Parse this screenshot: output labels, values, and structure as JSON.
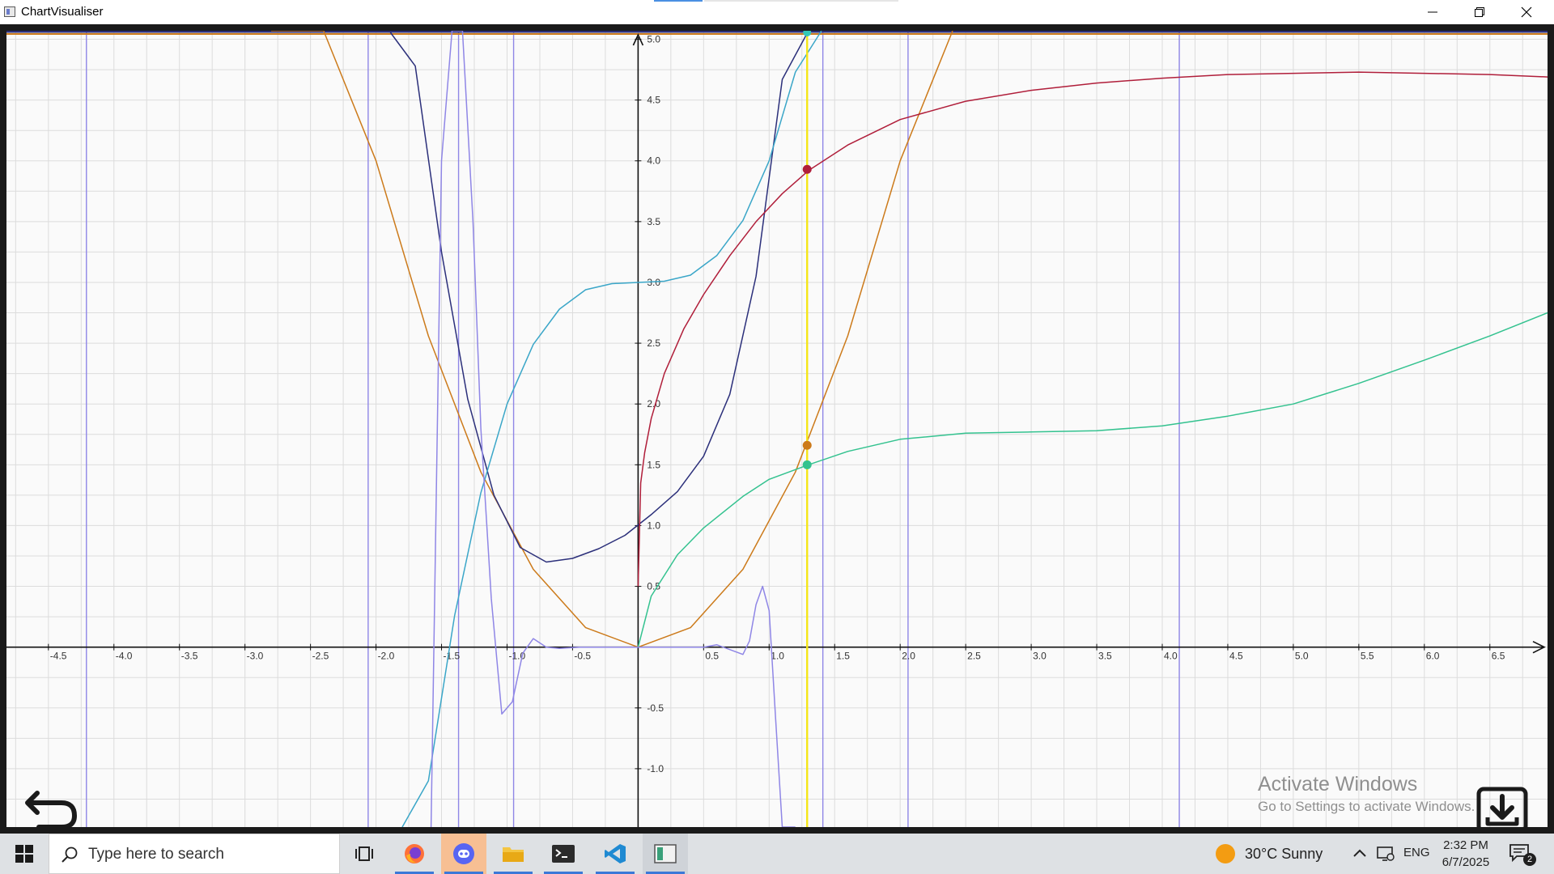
{
  "window": {
    "title": "ChartVisualiser"
  },
  "chart_data": {
    "type": "line",
    "xlim": [
      -4.82,
      6.94
    ],
    "ylim": [
      -1.48,
      5.07
    ],
    "grid": true,
    "x_ticks": [
      "-4.5",
      "-4.0",
      "-3.5",
      "-3.0",
      "-2.5",
      "-2.0",
      "-1.5",
      "-1.0",
      "-0.5",
      "0.5",
      "1.0",
      "1.5",
      "2.0",
      "2.5",
      "3.0",
      "3.5",
      "4.0",
      "4.5",
      "5.0",
      "5.5",
      "6.0",
      "6.5"
    ],
    "y_ticks": [
      "-1.0",
      "-0.5",
      "0.5",
      "1.0",
      "1.5",
      "2.0",
      "2.5",
      "3.0",
      "3.5",
      "4.0",
      "4.5",
      "5.0"
    ],
    "cursor_x": 1.29,
    "series": [
      {
        "color": "#cc7a1a",
        "x": [
          -2.8,
          -2.4,
          -2.0,
          -1.6,
          -1.2,
          -0.8,
          -0.4,
          0,
          0.4,
          0.8,
          1.2,
          1.6,
          2.0,
          2.4
        ],
        "y": [
          7.84,
          5.76,
          4.0,
          2.56,
          1.44,
          0.64,
          0.16,
          0,
          0.16,
          0.64,
          1.44,
          2.56,
          4.0,
          5.76
        ]
      },
      {
        "color": "#2b2f7a",
        "x": [
          -1.9,
          -1.7,
          -1.5,
          -1.3,
          -1.1,
          -0.9,
          -0.7,
          -0.5,
          -0.3,
          -0.1,
          0.1,
          0.3,
          0.5,
          0.7,
          0.9,
          1.1,
          1.3
        ],
        "y": [
          6.24,
          4.78,
          3.25,
          2.04,
          1.25,
          0.82,
          0.7,
          0.73,
          0.81,
          0.92,
          1.09,
          1.28,
          1.57,
          2.08,
          3.05,
          4.67,
          6.29
        ]
      },
      {
        "color": "#3aa6c8",
        "x": [
          -1.8,
          -1.6,
          -1.4,
          -1.2,
          -1.0,
          -0.8,
          -0.6,
          -0.4,
          -0.2,
          0,
          0.2,
          0.4,
          0.6,
          0.8,
          1.0,
          1.2,
          1.4
        ],
        "y": [
          -2.83,
          -1.1,
          0.26,
          1.27,
          2.0,
          2.49,
          2.78,
          2.94,
          2.99,
          3.0,
          3.01,
          3.06,
          3.22,
          3.51,
          4.0,
          4.73,
          5.74
        ]
      },
      {
        "color": "#b01e3a",
        "x": [
          0,
          0.02,
          0.05,
          0.1,
          0.2,
          0.35,
          0.5,
          0.7,
          0.9,
          1.1,
          1.3,
          1.6,
          2.0,
          2.5,
          3.0,
          3.5,
          4.0,
          4.5,
          5.0,
          5.5,
          6.0,
          6.5,
          6.94
        ],
        "y": [
          0.5,
          1.35,
          1.6,
          1.88,
          2.25,
          2.62,
          2.9,
          3.22,
          3.5,
          3.73,
          3.92,
          4.13,
          4.34,
          4.49,
          4.58,
          4.64,
          4.68,
          4.71,
          4.72,
          4.73,
          4.72,
          4.71,
          4.69
        ]
      },
      {
        "color": "#33c28f",
        "x": [
          0,
          0.1,
          0.3,
          0.5,
          0.8,
          1.0,
          1.3,
          1.6,
          2.0,
          2.5,
          3.0,
          3.5,
          4.0,
          4.5,
          5.0,
          5.5,
          6.0,
          6.5,
          6.94
        ],
        "y": [
          0,
          0.42,
          0.76,
          0.98,
          1.24,
          1.38,
          1.5,
          1.61,
          1.71,
          1.76,
          1.77,
          1.78,
          1.82,
          1.9,
          2.0,
          2.17,
          2.36,
          2.56,
          2.75
        ]
      },
      {
        "color": "#8f86e6",
        "x": [
          -1.58,
          -1.5,
          -1.42,
          -1.34,
          -1.26,
          -1.2,
          -1.12,
          -1.04,
          -0.96,
          -0.88,
          -0.8,
          -0.7,
          -0.6,
          -0.45,
          -0.3,
          0,
          0.3,
          0.5,
          0.6,
          0.7,
          0.8,
          0.85,
          0.9,
          0.95,
          1.0,
          1.05,
          1.1,
          1.2
        ],
        "y": [
          -1.5,
          4.0,
          6.0,
          5.2,
          3.5,
          1.8,
          0.4,
          -0.55,
          -0.45,
          -0.05,
          0.07,
          0.0,
          -0.01,
          0.0,
          0.0,
          0,
          0.0,
          0.0,
          0.02,
          -0.02,
          -0.06,
          0.05,
          0.35,
          0.5,
          0.3,
          -0.6,
          -1.5,
          -1.5
        ]
      }
    ],
    "cursor_points": [
      {
        "x": 1.29,
        "y": 3.93,
        "color": "#b01e3a"
      },
      {
        "x": 1.29,
        "y": 1.66,
        "color": "#cc7a1a"
      },
      {
        "x": 1.29,
        "y": 1.5,
        "color": "#33c28f"
      }
    ]
  },
  "watermark": {
    "title": "Activate Windows",
    "subtitle": "Go to Settings to activate Windows."
  },
  "taskbar": {
    "search_placeholder": "Type here to search",
    "weather": "30°C  Sunny",
    "language": "ENG",
    "time": "2:32 PM",
    "date": "6/7/2025",
    "notification_count": "2"
  }
}
